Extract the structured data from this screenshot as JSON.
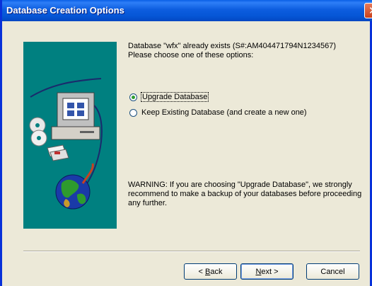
{
  "window": {
    "title": "Database Creation Options",
    "close_glyph": "✕"
  },
  "message": {
    "line1": "Database \"wfx\" already exists (S#:AM404471794N1234567)",
    "line2": "Please choose one of these options:"
  },
  "options": [
    {
      "label": "Upgrade Database",
      "selected": true
    },
    {
      "label": "Keep Existing Database (and create a new one)",
      "selected": false
    }
  ],
  "warning": "WARNING:  If you are choosing \"Upgrade Database\", we strongly recommend to make a backup of your databases before proceeding any further.",
  "buttons": {
    "back": {
      "mnemonic": "B",
      "rest": "ack",
      "prefix": "< "
    },
    "next": {
      "mnemonic": "N",
      "rest": "ext",
      "suffix": " >"
    },
    "cancel": "Cancel"
  },
  "icons": [
    "computer-icon",
    "cd-icon",
    "floppy-icon",
    "globe-icon",
    "close-icon"
  ],
  "colors": {
    "titlebar": "#0556d6",
    "art_background": "#008080",
    "dialog": "#ece9d8"
  }
}
